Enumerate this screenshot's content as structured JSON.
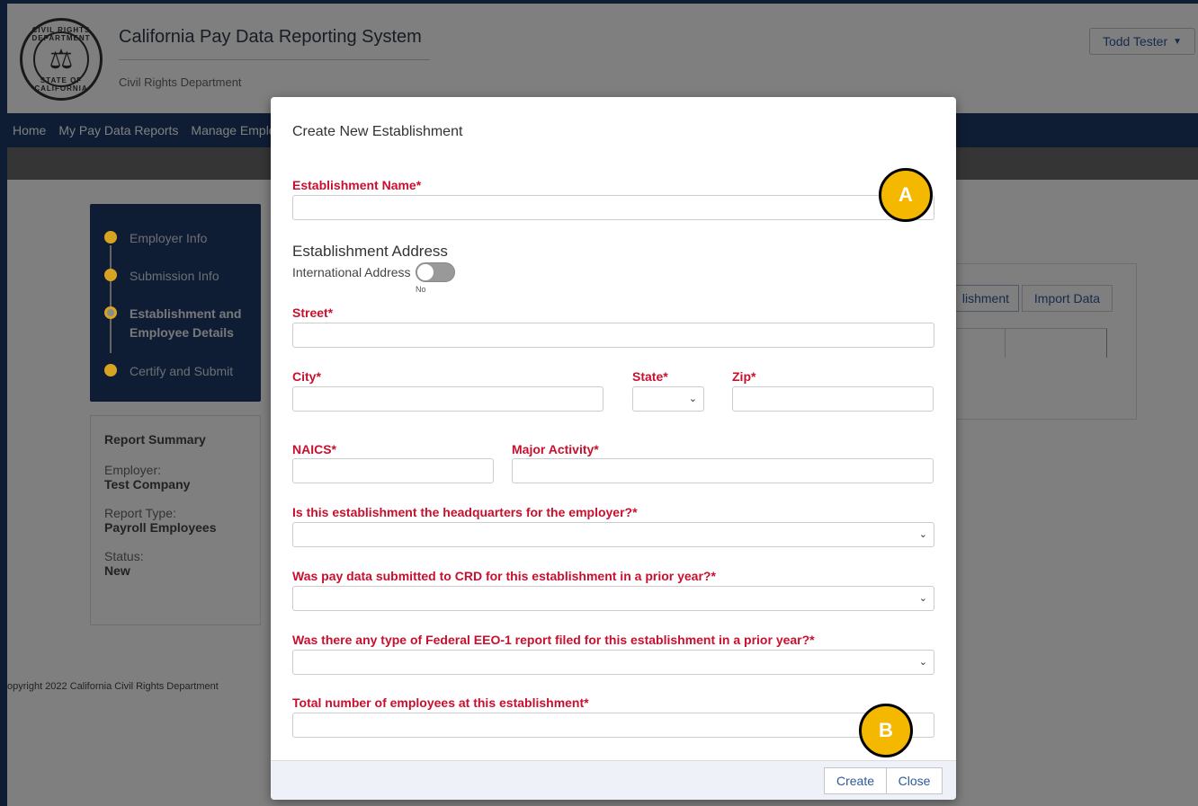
{
  "header": {
    "title": "California Pay Data Reporting System",
    "subtitle": "Civil Rights Department",
    "seal_top": "CIVIL RIGHTS DEPARTMENT",
    "seal_bottom": "STATE OF CALIFORNIA",
    "user": "Todd Tester"
  },
  "nav": {
    "items": [
      "Home",
      "My Pay Data Reports",
      "Manage Emplo"
    ]
  },
  "steps": [
    {
      "label": "Employer Info"
    },
    {
      "label": "Submission Info"
    },
    {
      "label": "Establishment and Employee Details"
    },
    {
      "label": "Certify and Submit"
    }
  ],
  "summary": {
    "title": "Report Summary",
    "employer_label": "Employer:",
    "employer_value": "Test Company",
    "report_type_label": "Report Type:",
    "report_type_value": "Payroll Employees",
    "status_label": "Status:",
    "status_value": "New"
  },
  "background_tabs": {
    "tab1": "lishment",
    "tab2": "Import Data"
  },
  "footer": {
    "copyright": "opyright 2022 California Civil Rights Department"
  },
  "modal": {
    "title": "Create New Establishment",
    "establishment_name_label": "Establishment Name*",
    "address_heading": "Establishment Address",
    "international_label": "International Address",
    "international_state": "No",
    "street_label": "Street*",
    "city_label": "City*",
    "state_label": "State*",
    "zip_label": "Zip*",
    "naics_label": "NAICS*",
    "major_activity_label": "Major Activity*",
    "hq_label": "Is this establishment the headquarters for the employer?*",
    "prior_year_label": "Was pay data submitted to CRD for this establishment in a prior year?*",
    "eeo1_label": "Was there any type of Federal EEO-1 report filed for this establishment in a prior year?*",
    "employees_label": "Total number of employees at this establishment*",
    "create_button": "Create",
    "close_button": "Close"
  },
  "markers": {
    "a": "A",
    "b": "B"
  },
  "colors": {
    "nav_blue": "#1e3a68",
    "required_red": "#c8102e",
    "step_gold": "#d7a322",
    "marker_yellow": "#f5b800"
  }
}
